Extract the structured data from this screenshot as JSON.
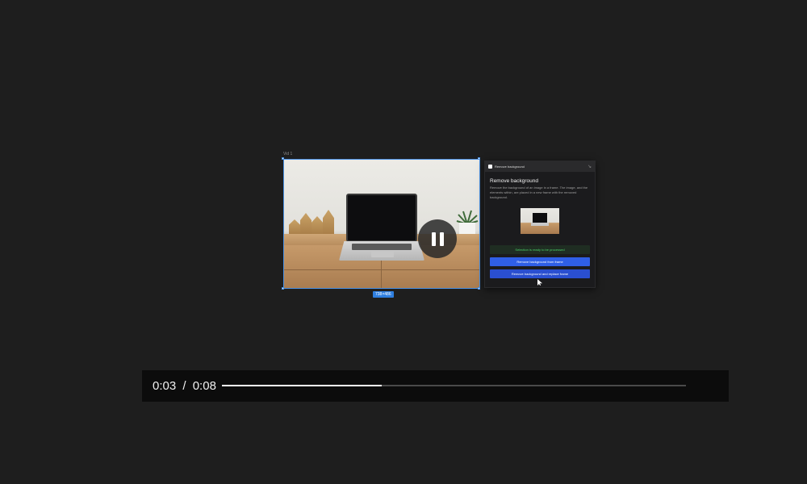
{
  "canvas": {
    "frame_name": "Vid 1",
    "size_badge": "738×486"
  },
  "video": {
    "current_time": "0:03",
    "separator": "/",
    "duration": "0:08",
    "progress_fraction": 0.345,
    "state": "playing",
    "pause_icon": "pause-icon"
  },
  "plugin_panel": {
    "header_title": "Remove background",
    "close_glyph": "↘",
    "title": "Remove background",
    "description": "Remove the background of an image in a frame. The image, and the elements within, are placed in a new frame with the removed background.",
    "status_message": "Selection is ready to be processed",
    "primary_button": "Remove background from frame",
    "secondary_button": "Remove background and replace frame"
  },
  "colors": {
    "accent": "#2f5fe6",
    "success": "#4cd36a",
    "selection": "#4a90e2"
  }
}
